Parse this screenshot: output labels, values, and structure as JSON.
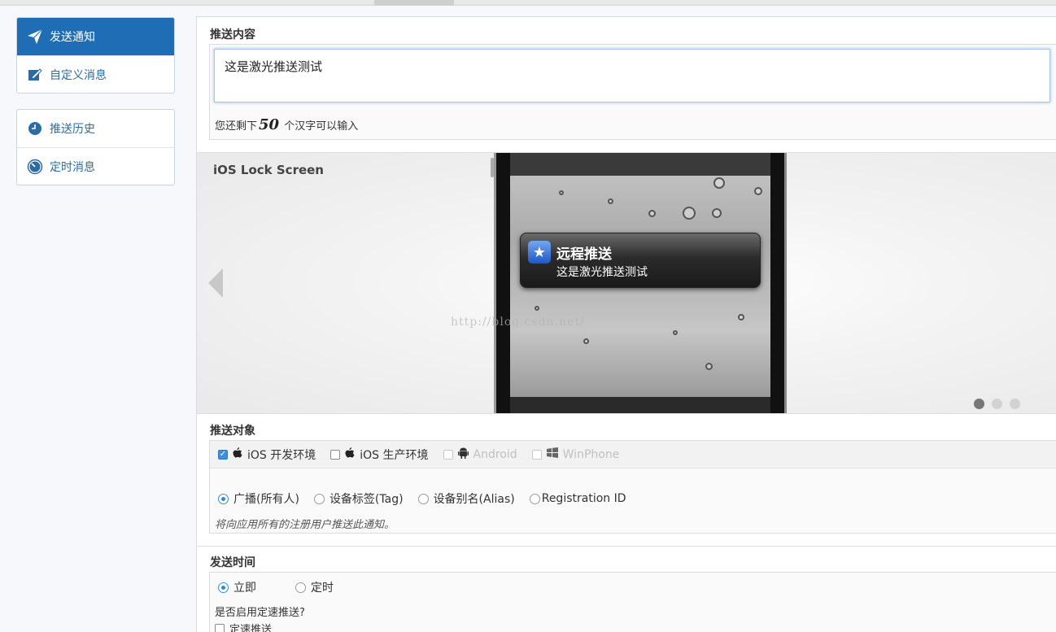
{
  "sidebar": {
    "group1": [
      {
        "label": "发送通知",
        "icon": "paper-plane-icon",
        "active": true
      },
      {
        "label": "自定义消息",
        "icon": "edit-icon",
        "active": false
      }
    ],
    "group2": [
      {
        "label": "推送历史",
        "icon": "clock-icon",
        "active": false
      },
      {
        "label": "定时消息",
        "icon": "timer-icon",
        "active": false
      }
    ]
  },
  "content": {
    "title": "推送内容",
    "textarea_value": "这是激光推送测试",
    "remain_prefix": "您还剩下",
    "remain_count": "50",
    "remain_suffix": "个汉字可以输入"
  },
  "preview": {
    "label": "iOS Lock Screen",
    "notification_title": "远程推送",
    "notification_body": "这是激光推送测试",
    "watermark": "http://blog.csdn.net/",
    "page_count": 3,
    "active_page": 1
  },
  "target": {
    "title": "推送对象",
    "platforms": [
      {
        "label": "iOS 开发环境",
        "checked": true,
        "disabled": false,
        "icon": "apple-icon"
      },
      {
        "label": "iOS 生产环境",
        "checked": false,
        "disabled": false,
        "icon": "apple-icon"
      },
      {
        "label": "Android",
        "checked": false,
        "disabled": true,
        "icon": "android-icon"
      },
      {
        "label": "WinPhone",
        "checked": false,
        "disabled": true,
        "icon": "windows-icon"
      }
    ],
    "audience": [
      {
        "label": "广播(所有人)",
        "selected": true
      },
      {
        "label": "设备标签(Tag)",
        "selected": false
      },
      {
        "label": "设备别名(Alias)",
        "selected": false
      },
      {
        "label": "Registration ID",
        "selected": false
      }
    ],
    "hint": "将向应用所有的注册用户推送此通知。"
  },
  "time": {
    "title": "发送时间",
    "options": [
      {
        "label": "立即",
        "selected": true
      },
      {
        "label": "定时",
        "selected": false
      }
    ],
    "question": "是否启用定速推送?",
    "speed_label": "定速推送",
    "speed_checked": false
  },
  "colors": {
    "accent": "#1f6db5",
    "link": "#2d6ca2"
  }
}
